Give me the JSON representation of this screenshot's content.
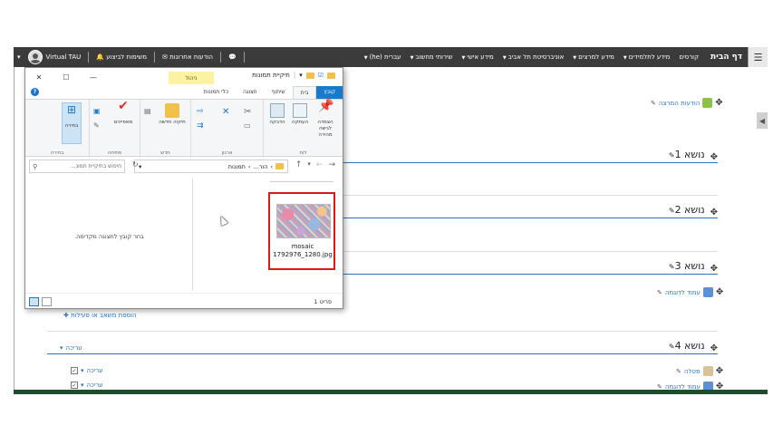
{
  "topbar": {
    "menu_icon": "hamburger-icon",
    "home": "דף הבית",
    "nav_items": [
      "קורסים",
      "מידע לתלמידים",
      "מידע למרצים",
      "אוניברסיטת תל אביב",
      "מידע אישי",
      "שירותי מחשוב",
      "עברית (he)"
    ],
    "user_name": "Virtual TAU",
    "messages_label": "הודעות אחרונות",
    "tasks_label": "משימות לביצוע",
    "chat_icon": "chat-icon",
    "envelope_icon": "envelope-icon",
    "bell_icon": "bell-icon"
  },
  "course": {
    "news_label": "הודעות המרצה",
    "sections": [
      {
        "title": "נושא 1"
      },
      {
        "title": "נושא 2"
      },
      {
        "title": "נושא 3"
      },
      {
        "title": "נושא 4"
      }
    ],
    "section3_activity": "עמוד לדוגמה",
    "add_activity": "הוספת משאב או פעילות",
    "edit_label": "עריכה",
    "section4_activity1": "מטלה",
    "section4_activity2": "עמוד לדוגמה",
    "edit_item1": "עריכה",
    "edit_item2": "עריכה"
  },
  "explorer": {
    "title": "תמונות",
    "window_title_prefix": "תיקיית תמונות",
    "manage_tab": "ניהול",
    "tabs": [
      "קובץ",
      "בית",
      "שיתוף",
      "תצוגה",
      "כלי תמונות"
    ],
    "ribbon": {
      "clipboard_group": "לוח",
      "organize_group": "ארגון",
      "new_group": "חדש",
      "open_group": "פתיחה",
      "select_group": "בחירה",
      "pin_label": "הצמדה לגישה מהירה",
      "copy_label": "העתקה",
      "paste_label": "הדבקה",
      "new_folder_label": "תיקיה חדשה",
      "properties_label": "מאפיינים",
      "select_label": "בחירה"
    },
    "address": "תמונות",
    "address_parent": "הור...",
    "search_placeholder": "חיפוש בתיקיית תמונ...",
    "preview_message": "בחר קובץ לתצוגה מקדימה.",
    "file_name": "mosaic 1792976_1280.jpg",
    "status": "פריט 1"
  },
  "colors": {
    "topbar_bg": "#3b3b3b",
    "section_line": "#2b75c2",
    "highlight": "#e01818",
    "file_tab": "#1979ca"
  }
}
